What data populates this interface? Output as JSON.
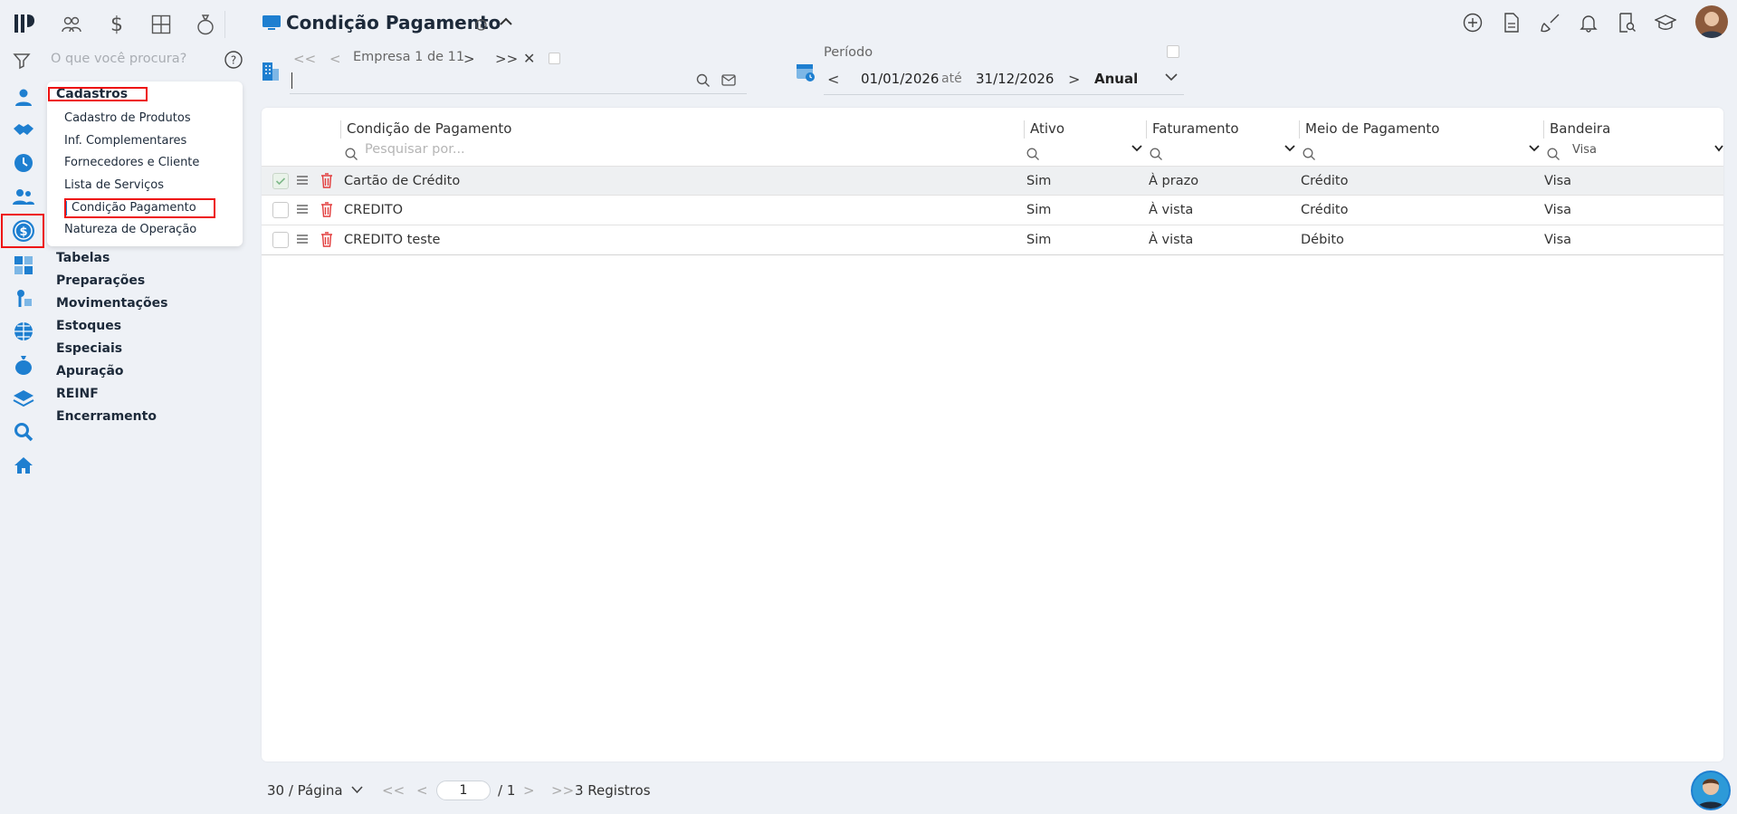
{
  "header": {
    "title": "Condição Pagamento",
    "title_icon": "monitor-icon"
  },
  "search": {
    "placeholder": "O que você procura?"
  },
  "company_nav": {
    "label": "Empresa 1 de 11",
    "input_value": ""
  },
  "period": {
    "label": "Período",
    "from": "01/01/2026",
    "sep": "até",
    "to": "31/12/2026",
    "mode": "Anual"
  },
  "menu": {
    "section": "Cadastros",
    "items": [
      {
        "label": "Cadastro de Produtos"
      },
      {
        "label": "Inf. Complementares"
      },
      {
        "label": "Fornecedores e Cliente"
      },
      {
        "label": "Lista de Serviços"
      },
      {
        "label": "Condição Pagamento"
      },
      {
        "label": "Natureza de Operação"
      }
    ],
    "groups": [
      {
        "label": "Tabelas"
      },
      {
        "label": "Preparações"
      },
      {
        "label": "Movimentações"
      },
      {
        "label": "Estoques"
      },
      {
        "label": "Especiais"
      },
      {
        "label": "Apuração"
      },
      {
        "label": "REINF"
      },
      {
        "label": "Encerramento"
      }
    ]
  },
  "grid": {
    "columns": [
      "Condição de Pagamento",
      "Ativo",
      "Faturamento",
      "Meio de Pagamento",
      "Bandeira"
    ],
    "search_placeholder": "Pesquisar por...",
    "bandeira_filter": "Visa",
    "rows": [
      {
        "name": "Cartão de Crédito",
        "ativo": "Sim",
        "faturamento": "À prazo",
        "meio": "Crédito",
        "bandeira": "Visa",
        "selected": true
      },
      {
        "name": "CREDITO",
        "ativo": "Sim",
        "faturamento": "À vista",
        "meio": "Crédito",
        "bandeira": "Visa",
        "selected": false
      },
      {
        "name": "CREDITO teste",
        "ativo": "Sim",
        "faturamento": "À vista",
        "meio": "Débito",
        "bandeira": "Visa",
        "selected": false
      }
    ]
  },
  "footer": {
    "page_size": "30 / Página",
    "page": "1",
    "total_pages": "/ 1",
    "records": "3 Registros"
  },
  "colors": {
    "accent": "#1e7fd0",
    "danger": "#e23c3c",
    "highlight_box": "#e11111"
  }
}
